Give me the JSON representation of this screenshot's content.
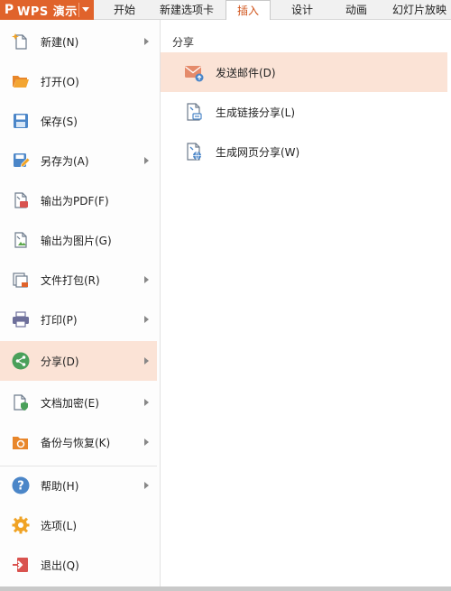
{
  "app": {
    "name": "WPS 演示",
    "logo_glyph": "P",
    "accent": "#e0632b"
  },
  "tabs": [
    {
      "label": "开始",
      "active": false
    },
    {
      "label": "新建选项卡",
      "active": false
    },
    {
      "label": "插入",
      "active": true
    },
    {
      "label": "设计",
      "active": false
    },
    {
      "label": "动画",
      "active": false
    },
    {
      "label": "幻灯片放映",
      "active": false
    }
  ],
  "menu": {
    "items": [
      {
        "label": "新建(N)",
        "icon": "new-file-icon",
        "has_submenu": true
      },
      {
        "label": "打开(O)",
        "icon": "open-folder-icon",
        "has_submenu": false
      },
      {
        "label": "保存(S)",
        "icon": "save-icon",
        "has_submenu": false
      },
      {
        "label": "另存为(A)",
        "icon": "save-as-icon",
        "has_submenu": true
      },
      {
        "label": "输出为PDF(F)",
        "icon": "pdf-icon",
        "has_submenu": false
      },
      {
        "label": "输出为图片(G)",
        "icon": "image-icon",
        "has_submenu": false
      },
      {
        "label": "文件打包(R)",
        "icon": "package-icon",
        "has_submenu": true
      },
      {
        "label": "打印(P)",
        "icon": "print-icon",
        "has_submenu": true
      },
      {
        "label": "分享(D)",
        "icon": "share-icon",
        "has_submenu": true,
        "active": true
      },
      {
        "label": "文档加密(E)",
        "icon": "encrypt-icon",
        "has_submenu": true
      },
      {
        "label": "备份与恢复(K)",
        "icon": "backup-icon",
        "has_submenu": true
      },
      {
        "label": "帮助(H)",
        "icon": "help-icon",
        "has_submenu": true
      },
      {
        "label": "选项(L)",
        "icon": "options-icon",
        "has_submenu": false
      },
      {
        "label": "退出(Q)",
        "icon": "exit-icon",
        "has_submenu": false
      }
    ]
  },
  "share_panel": {
    "title": "分享",
    "items": [
      {
        "label": "发送邮件(D)",
        "icon": "mail-icon",
        "active": true
      },
      {
        "label": "生成链接分享(L)",
        "icon": "link-share-icon",
        "active": false
      },
      {
        "label": "生成网页分享(W)",
        "icon": "web-share-icon",
        "active": false
      }
    ]
  }
}
